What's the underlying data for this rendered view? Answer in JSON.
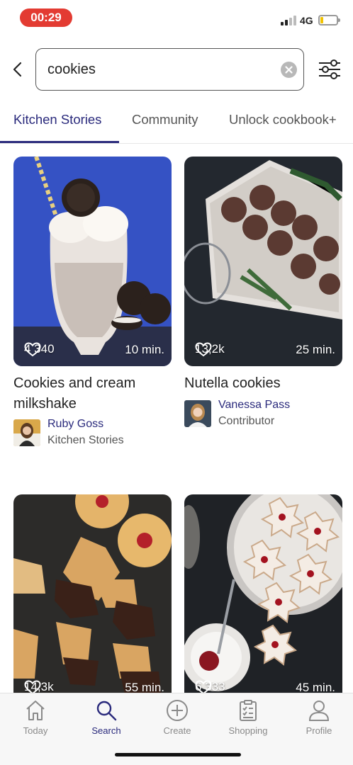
{
  "status_bar": {
    "time": "00:29",
    "network": "4G",
    "battery_level": 0.2,
    "colors": {
      "time_pill": "#e33b32",
      "battery": "#f2c300"
    }
  },
  "search": {
    "value": "cookies",
    "back_icon": "chevron-left-icon",
    "clear_icon": "clear-circle-icon",
    "filter_icon": "sliders-icon"
  },
  "tabs": [
    {
      "label": "Kitchen Stories",
      "active": true
    },
    {
      "label": "Community",
      "active": false
    },
    {
      "label": "Unlock cookbook+",
      "active": false
    }
  ],
  "accent_color": "#2a2a7c",
  "recipes": [
    {
      "title": "Cookies and cream milkshake",
      "likes": "4 340",
      "duration": "10 min.",
      "author": "Ruby Goss",
      "role": "Kitchen Stories"
    },
    {
      "title": "Nutella cookies",
      "likes": "13,2k",
      "duration": "25 min.",
      "author": "Vanessa Pass",
      "role": "Contributor"
    },
    {
      "likes": "14,3k",
      "duration": "55 min."
    },
    {
      "likes": "6 333",
      "duration": "45 min."
    }
  ],
  "bottom_nav": [
    {
      "label": "Today",
      "icon": "home-icon",
      "active": false
    },
    {
      "label": "Search",
      "icon": "search-icon",
      "active": true
    },
    {
      "label": "Create",
      "icon": "plus-circle-icon",
      "active": false
    },
    {
      "label": "Shopping",
      "icon": "checklist-icon",
      "active": false
    },
    {
      "label": "Profile",
      "icon": "user-icon",
      "active": false
    }
  ]
}
